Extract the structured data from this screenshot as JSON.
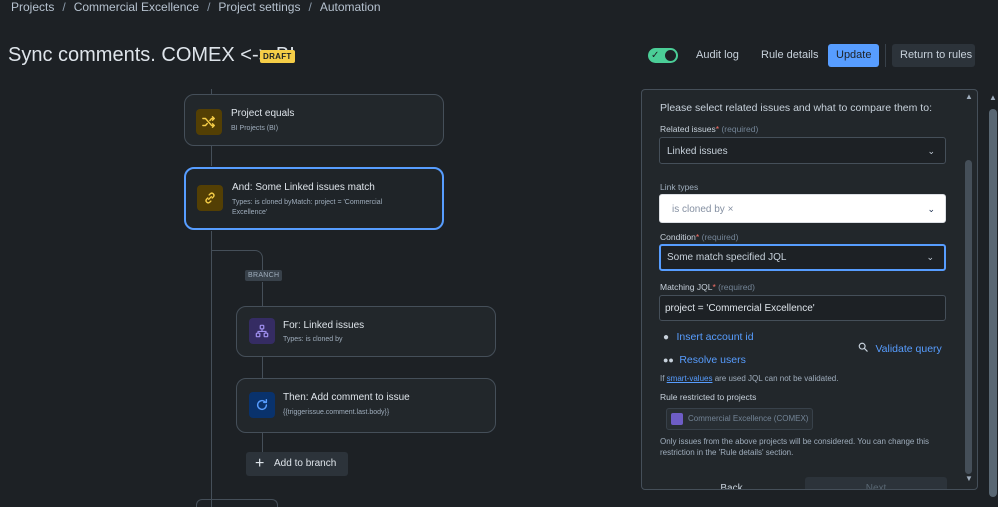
{
  "breadcrumb": [
    "Projects",
    "Commercial Excellence",
    "Project settings",
    "Automation"
  ],
  "breadcrumb_separator": "/",
  "header": {
    "title": "Sync comments. COMEX <-> BI",
    "status_badge": "DRAFT",
    "toggle_on": true,
    "audit_log_label": "Audit log",
    "rule_details_label": "Rule details",
    "update_label": "Update",
    "return_label": "Return to rules"
  },
  "flow": {
    "condition_card": {
      "title": "Project equals",
      "subtitle": "BI Projects (BI)",
      "icon": "shuffle-icon"
    },
    "linked_card": {
      "title": "And: Some Linked issues match",
      "subtitle_line1": "Types: is cloned byMatch: project = 'Commercial",
      "subtitle_line2": "Excellence'",
      "icon": "link-icon"
    },
    "branch_label": "BRANCH",
    "branch_card": {
      "title": "For: Linked issues",
      "subtitle": "Types: is cloned by",
      "icon": "hierarchy-icon"
    },
    "action_card": {
      "title": "Then: Add comment to issue",
      "subtitle": "{{triggerissue.comment.last.body}}",
      "icon": "refresh-icon"
    },
    "add_branch_label": "Add to branch"
  },
  "panel": {
    "intro": "Please select related issues and what to compare them to:",
    "related_issues": {
      "label": "Related issues",
      "required_mark": "*",
      "required_text": "(required)",
      "value": "Linked issues"
    },
    "link_types": {
      "label": "Link types",
      "chip": "is cloned by",
      "chip_remove": "×"
    },
    "condition": {
      "label": "Condition",
      "required_mark": "*",
      "required_text": "(required)",
      "value": "Some match specified JQL"
    },
    "matching_jql": {
      "label": "Matching JQL",
      "required_mark": "*",
      "required_text": "(required)",
      "value": "project = 'Commercial Excellence'"
    },
    "insert_account_label": "Insert account id",
    "resolve_users_label": "Resolve users",
    "validate_query_label": "Validate query",
    "smart_note_prefix": "If ",
    "smart_note_link": "smart-values",
    "smart_note_suffix": " are used JQL can not be validated.",
    "restricted": {
      "label": "Rule restricted to projects",
      "project": "Commercial Excellence (COMEX)"
    },
    "restrict_note_line1": "Only issues from the above projects will be considered. You can change this",
    "restrict_note_line2": "restriction in the 'Rule details' section.",
    "back_label": "Back",
    "next_label": "Next"
  },
  "colors": {
    "background": "#1d2125",
    "accent": "#579dff",
    "toggle_on": "#4bce97",
    "draft_badge": "#f5cd47",
    "required": "#f87168"
  }
}
